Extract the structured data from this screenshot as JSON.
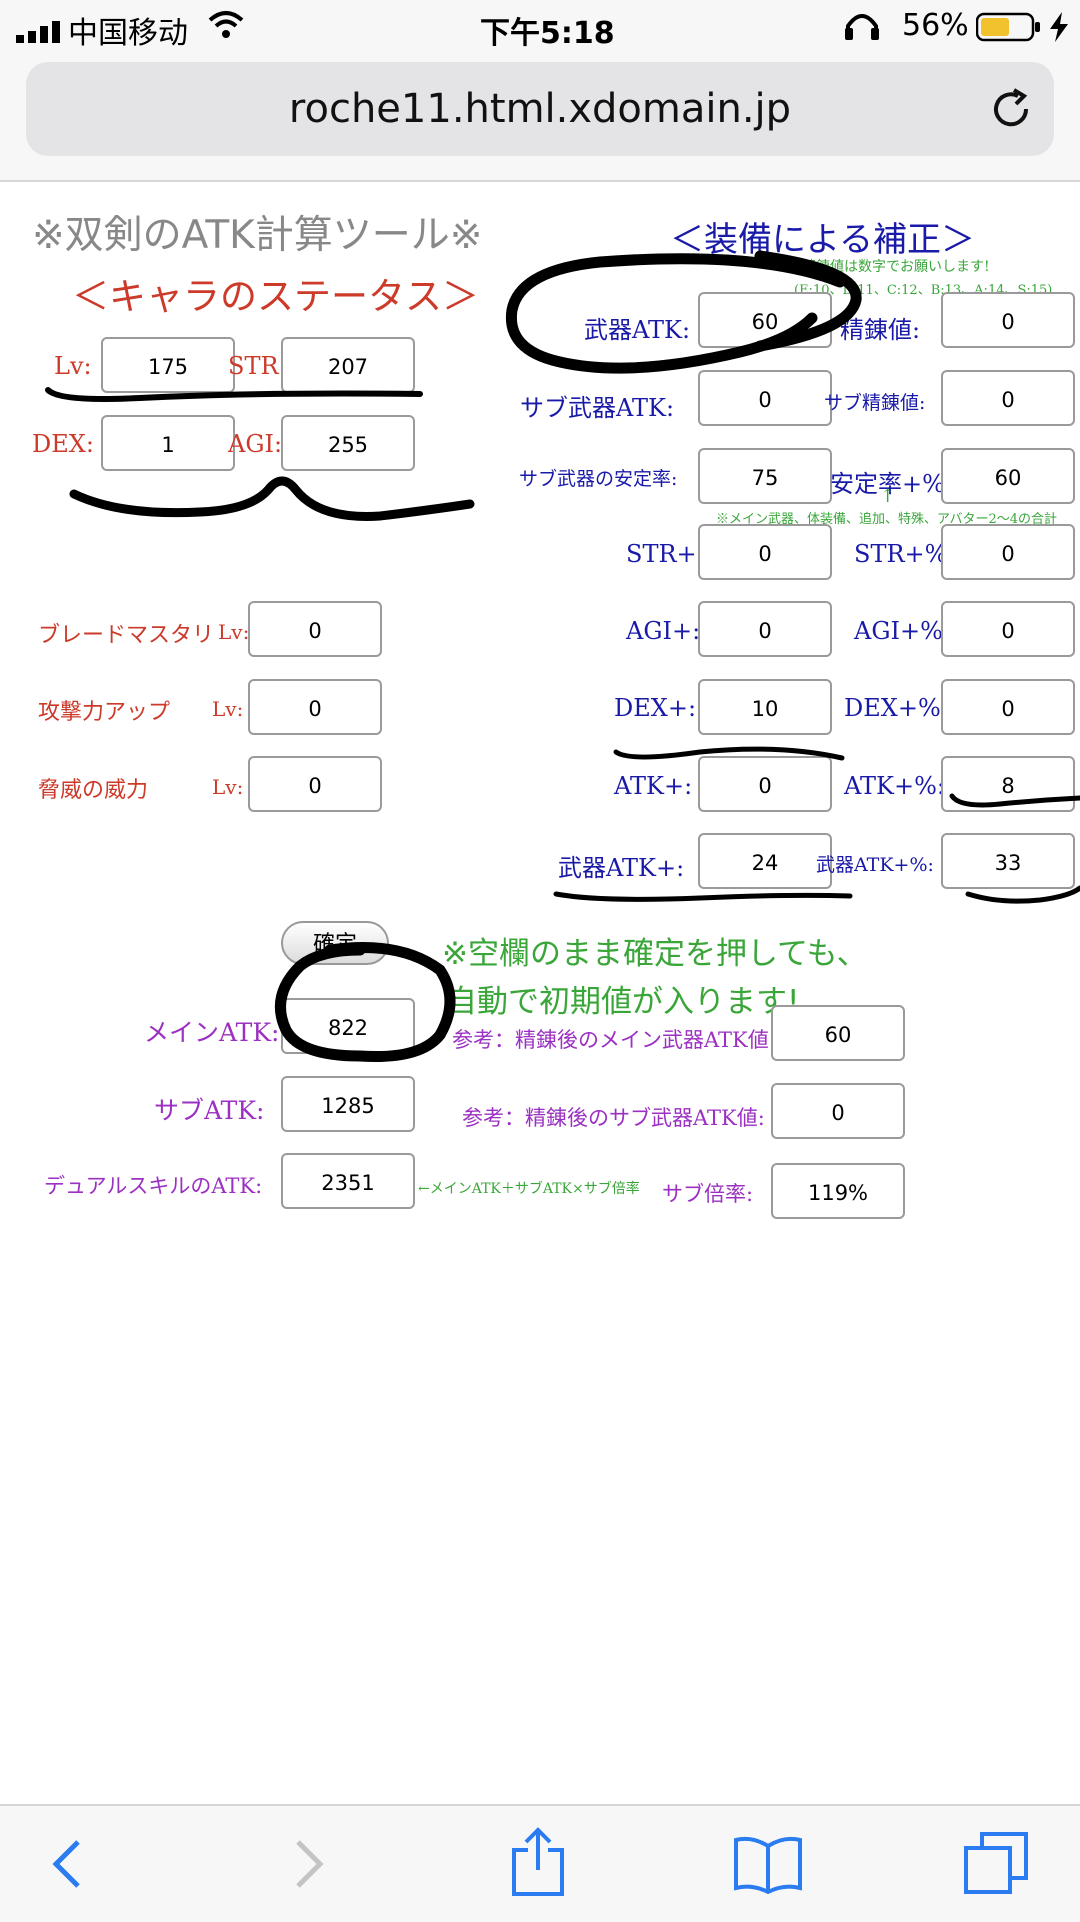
{
  "status": {
    "carrier": "中国移动",
    "time": "下午5:18",
    "battery": "56%"
  },
  "browser": {
    "url": "roche11.html.xdomain.jp"
  },
  "page": {
    "title": "※双剣のATK計算ツール※",
    "char_heading": "＜キャラのステータス＞",
    "equip_heading": "＜装備による補正＞",
    "refine_note": "精錬値は数字でお願いします!",
    "refine_scale": "(E:10、D:11、C:12、B:13、A:14、S:15)",
    "stability_arrow": "↑",
    "stability_note": "※メイン武器、体装備、追加、特殊、アバター2〜4の合計",
    "empty_note_line1": "※空欄のまま確定を押しても、",
    "empty_note_line2": "自動で初期値が入ります!",
    "dual_note": "←メインATK＋サブATK×サブ倍率"
  },
  "char": {
    "lv": {
      "label": "Lv:",
      "value": "175"
    },
    "str": {
      "label": "STR:",
      "value": "207"
    },
    "dex": {
      "label": "DEX:",
      "value": "1"
    },
    "agi": {
      "label": "AGI:",
      "value": "255"
    }
  },
  "skills": {
    "blade": {
      "label": "ブレードマスタリ",
      "lv": "Lv:",
      "value": "0"
    },
    "atkup": {
      "label": "攻撃力アップ",
      "lv": "Lv:",
      "value": "0"
    },
    "threat": {
      "label": "脅威の威力",
      "lv": "Lv:",
      "value": "0"
    }
  },
  "equip": {
    "weapon_atk": {
      "label": "武器ATK:",
      "value": "60"
    },
    "refine": {
      "label": "精錬値:",
      "value": "0"
    },
    "sub_weapon_atk": {
      "label": "サブ武器ATK:",
      "value": "0"
    },
    "sub_refine": {
      "label": "サブ精錬値:",
      "value": "0"
    },
    "sub_stability": {
      "label": "サブ武器の安定率:",
      "value": "75"
    },
    "stability_pct": {
      "label": "安定率+%:",
      "value": "60"
    },
    "str_plus": {
      "label": "STR+:",
      "value": "0"
    },
    "str_pct": {
      "label": "STR+%:",
      "value": "0"
    },
    "agi_plus": {
      "label": "AGI+:",
      "value": "0"
    },
    "agi_pct": {
      "label": "AGI+%:",
      "value": "0"
    },
    "dex_plus": {
      "label": "DEX+:",
      "value": "10"
    },
    "dex_pct": {
      "label": "DEX+%:",
      "value": "0"
    },
    "atk_plus": {
      "label": "ATK+:",
      "value": "0"
    },
    "atk_pct": {
      "label": "ATK+%:",
      "value": "8"
    },
    "weapon_atk_plus": {
      "label": "武器ATK+:",
      "value": "24"
    },
    "weapon_atk_pct": {
      "label": "武器ATK+%:",
      "value": "33"
    }
  },
  "confirm": {
    "label": "確定"
  },
  "results": {
    "main_atk": {
      "label": "メインATK:",
      "value": "822"
    },
    "sub_atk": {
      "label": "サブATK:",
      "value": "1285"
    },
    "dual_atk": {
      "label": "デュアルスキルのATK:",
      "value": "2351"
    },
    "ref_main": {
      "label": "参考：精錬後のメイン武器ATK値:",
      "value": "60"
    },
    "ref_sub": {
      "label": "参考：精錬後のサブ武器ATK値:",
      "value": "0"
    },
    "sub_ratio": {
      "label": "サブ倍率:",
      "value": "119%"
    }
  }
}
